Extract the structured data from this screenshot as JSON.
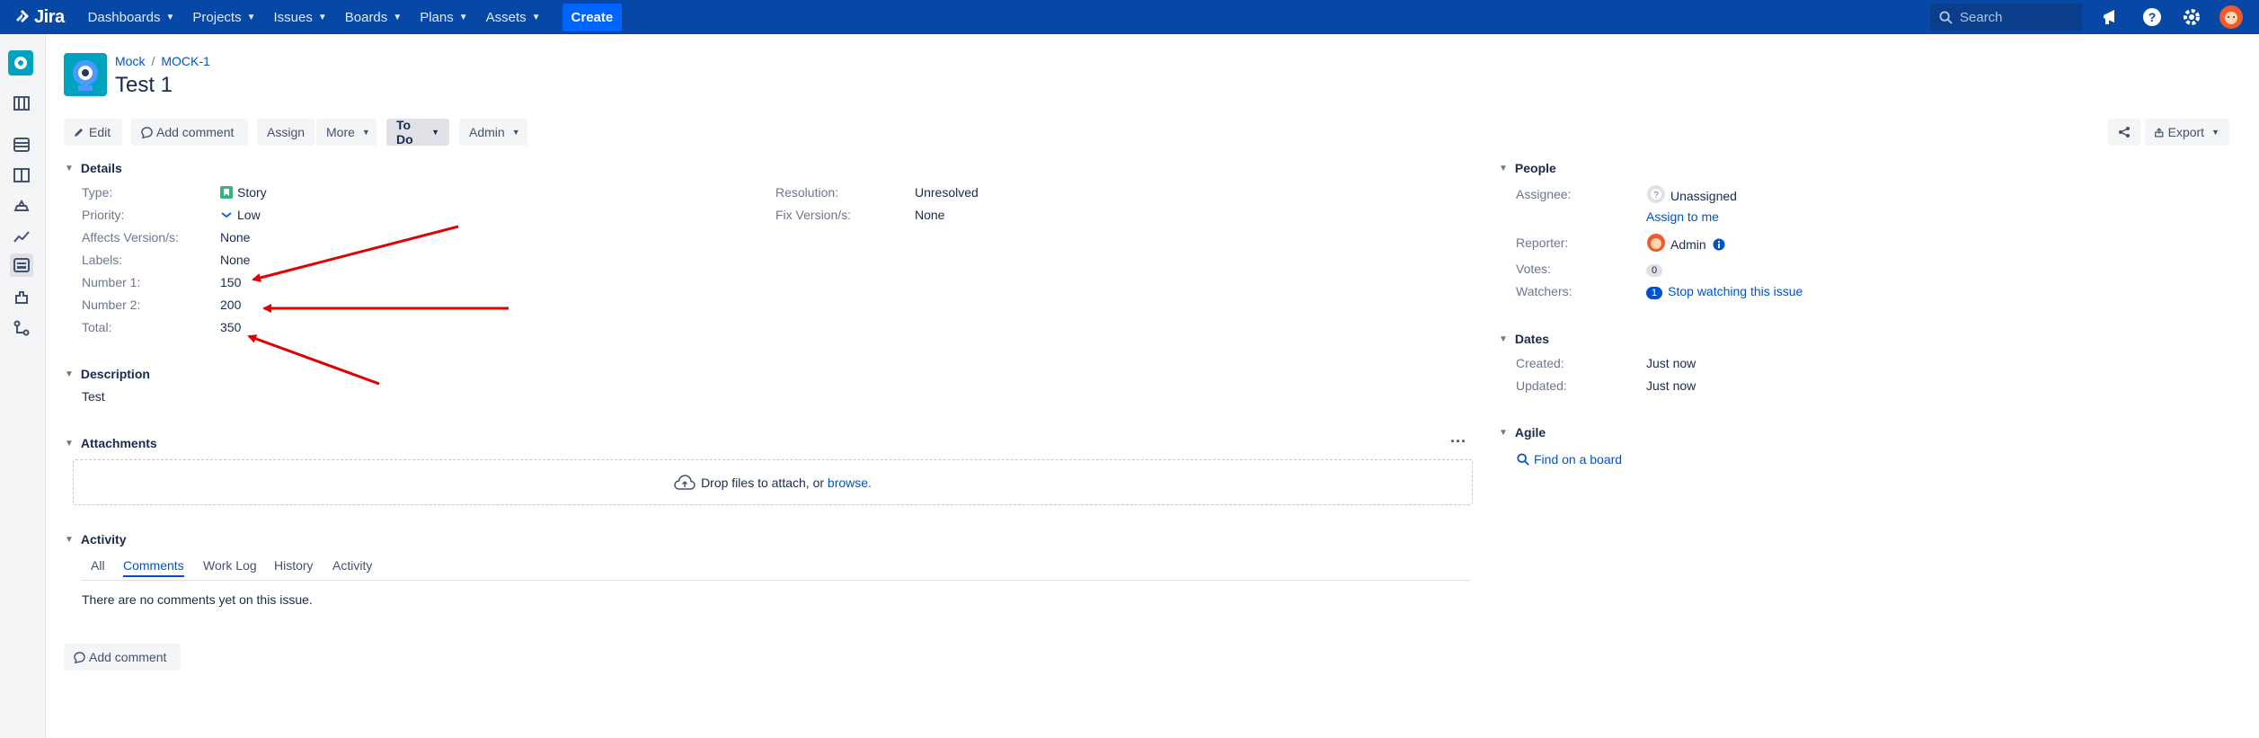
{
  "topnav": {
    "logo": "Jira",
    "items": [
      "Dashboards",
      "Projects",
      "Issues",
      "Boards",
      "Plans",
      "Assets"
    ],
    "create_label": "Create",
    "search_placeholder": "Search"
  },
  "breadcrumb": {
    "project": "Mock",
    "issue_key": "MOCK-1"
  },
  "issue": {
    "title": "Test 1"
  },
  "toolbar": {
    "edit": "Edit",
    "add_comment": "Add comment",
    "assign": "Assign",
    "more": "More",
    "status": "To Do",
    "admin": "Admin",
    "export": "Export"
  },
  "details": {
    "header": "Details",
    "fields": [
      {
        "label": "Type:",
        "value": "Story"
      },
      {
        "label": "Priority:",
        "value": "Low"
      },
      {
        "label": "Affects Version/s:",
        "value": "None"
      },
      {
        "label": "Labels:",
        "value": "None"
      },
      {
        "label": "Number 1:",
        "value": "150"
      },
      {
        "label": "Number 2:",
        "value": "200"
      },
      {
        "label": "Total:",
        "value": "350"
      }
    ],
    "right_fields": [
      {
        "label": "Resolution:",
        "value": "Unresolved"
      },
      {
        "label": "Fix Version/s:",
        "value": "None"
      }
    ]
  },
  "description": {
    "header": "Description",
    "text": "Test"
  },
  "attachments": {
    "header": "Attachments",
    "drop_text": "Drop files to attach, or",
    "browse": "browse."
  },
  "activity": {
    "header": "Activity",
    "tabs": [
      "All",
      "Comments",
      "Work Log",
      "History",
      "Activity"
    ],
    "active_tab": "Comments",
    "empty_text": "There are no comments yet on this issue.",
    "add_comment": "Add comment"
  },
  "people": {
    "header": "People",
    "assignee_label": "Assignee:",
    "assignee": "Unassigned",
    "assign_to_me": "Assign to me",
    "reporter_label": "Reporter:",
    "reporter": "Admin",
    "votes_label": "Votes:",
    "votes": "0",
    "watchers_label": "Watchers:",
    "watchers": "1",
    "watch_link": "Stop watching this issue"
  },
  "dates": {
    "header": "Dates",
    "created_label": "Created:",
    "created": "Just now",
    "updated_label": "Updated:",
    "updated": "Just now"
  },
  "agile": {
    "header": "Agile",
    "link": "Find on a board"
  },
  "colors": {
    "nav": "#0747a6",
    "link": "#0052cc",
    "annotation": "#e00000"
  },
  "annotation_arrows": 3
}
